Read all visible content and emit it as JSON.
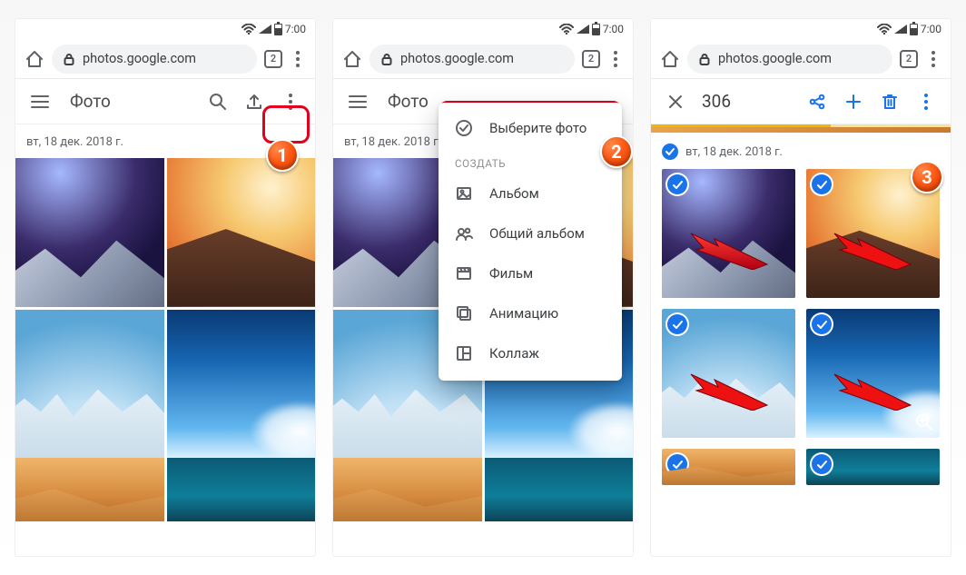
{
  "status": {
    "time": "7:00"
  },
  "browser": {
    "url": "photos.google.com",
    "tab_count": "2"
  },
  "screen1": {
    "toolbar": {
      "title": "Фото"
    },
    "date": "вт, 18 дек. 2018 г.",
    "badge": "1"
  },
  "screen2": {
    "toolbar": {
      "title": "Фото"
    },
    "date": "вт, 18 дек. 2018 г.",
    "menu": {
      "select": "Выберите фото",
      "heading": "СОЗДАТЬ",
      "album": "Альбом",
      "shared_album": "Общий альбом",
      "movie": "Фильм",
      "animation": "Анимацию",
      "collage": "Коллаж"
    },
    "badge": "2"
  },
  "screen3": {
    "toolbar": {
      "count": "306"
    },
    "date": "вт, 18 дек. 2018 г.",
    "badge": "3"
  }
}
